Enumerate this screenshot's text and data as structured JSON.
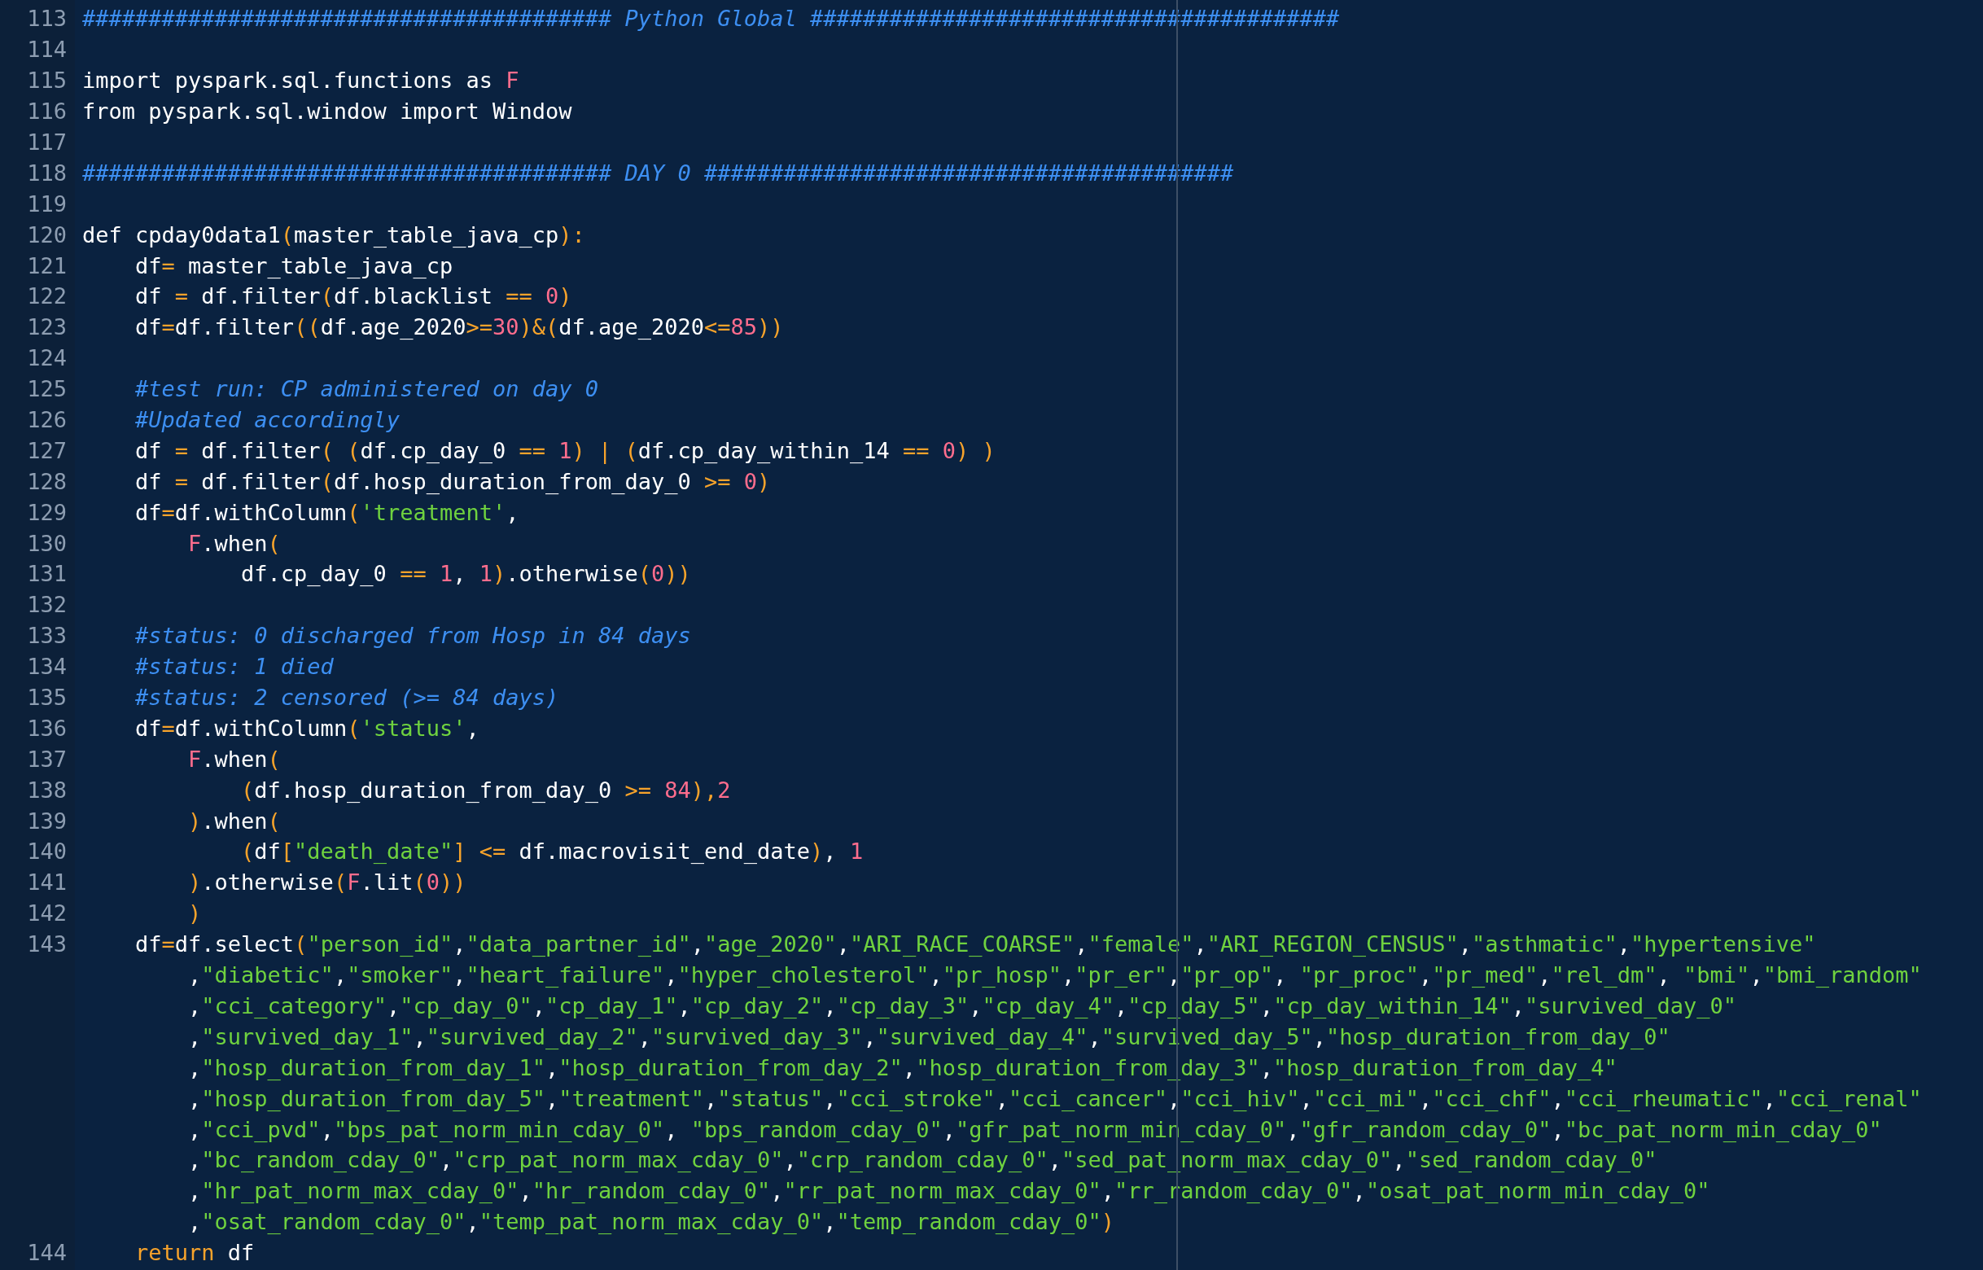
{
  "editor": {
    "rows": [
      {
        "number": "113",
        "segments": [
          {
            "kind": "comment",
            "text": "######################################## Python Global ########################################"
          }
        ]
      },
      {
        "number": "114",
        "segments": []
      },
      {
        "number": "115",
        "segments": [
          {
            "kind": "plain",
            "text": "import pyspark.sql.functions as "
          },
          {
            "kind": "constant",
            "text": "F"
          }
        ]
      },
      {
        "number": "116",
        "segments": [
          {
            "kind": "plain",
            "text": "from pyspark.sql.window import Window"
          }
        ]
      },
      {
        "number": "117",
        "segments": []
      },
      {
        "number": "118",
        "segments": [
          {
            "kind": "comment",
            "text": "######################################## DAY 0 ########################################"
          }
        ]
      },
      {
        "number": "119",
        "segments": []
      },
      {
        "number": "120",
        "segments": [
          {
            "kind": "plain",
            "text": "def cpday0data1"
          },
          {
            "kind": "operator",
            "text": "("
          },
          {
            "kind": "plain",
            "text": "master_table_java_cp"
          },
          {
            "kind": "operator",
            "text": "):"
          }
        ]
      },
      {
        "number": "121",
        "segments": [
          {
            "kind": "plain",
            "text": "    df"
          },
          {
            "kind": "operator",
            "text": "="
          },
          {
            "kind": "plain",
            "text": " master_table_java_cp"
          }
        ]
      },
      {
        "number": "122",
        "segments": [
          {
            "kind": "plain",
            "text": "    df "
          },
          {
            "kind": "operator",
            "text": "="
          },
          {
            "kind": "plain",
            "text": " df.filter"
          },
          {
            "kind": "operator",
            "text": "("
          },
          {
            "kind": "plain",
            "text": "df.blacklist "
          },
          {
            "kind": "operator",
            "text": "== "
          },
          {
            "kind": "number",
            "text": "0"
          },
          {
            "kind": "operator",
            "text": ")"
          }
        ]
      },
      {
        "number": "123",
        "segments": [
          {
            "kind": "plain",
            "text": "    df"
          },
          {
            "kind": "operator",
            "text": "="
          },
          {
            "kind": "plain",
            "text": "df.filter"
          },
          {
            "kind": "operator",
            "text": "(("
          },
          {
            "kind": "plain",
            "text": "df.age_2020"
          },
          {
            "kind": "operator",
            "text": ">="
          },
          {
            "kind": "number",
            "text": "30"
          },
          {
            "kind": "operator",
            "text": ")&("
          },
          {
            "kind": "plain",
            "text": "df.age_2020"
          },
          {
            "kind": "operator",
            "text": "<="
          },
          {
            "kind": "number",
            "text": "85"
          },
          {
            "kind": "operator",
            "text": "))"
          }
        ]
      },
      {
        "number": "124",
        "segments": []
      },
      {
        "number": "125",
        "segments": [
          {
            "kind": "comment",
            "text": "    #test run: CP administered on day 0"
          }
        ]
      },
      {
        "number": "126",
        "segments": [
          {
            "kind": "comment",
            "text": "    #Updated accordingly"
          }
        ]
      },
      {
        "number": "127",
        "segments": [
          {
            "kind": "plain",
            "text": "    df "
          },
          {
            "kind": "operator",
            "text": "="
          },
          {
            "kind": "plain",
            "text": " df.filter"
          },
          {
            "kind": "operator",
            "text": "( ("
          },
          {
            "kind": "plain",
            "text": "df.cp_day_0 "
          },
          {
            "kind": "operator",
            "text": "== "
          },
          {
            "kind": "number",
            "text": "1"
          },
          {
            "kind": "operator",
            "text": ") | ("
          },
          {
            "kind": "plain",
            "text": "df.cp_day_within_14 "
          },
          {
            "kind": "operator",
            "text": "== "
          },
          {
            "kind": "number",
            "text": "0"
          },
          {
            "kind": "operator",
            "text": ") )"
          }
        ]
      },
      {
        "number": "128",
        "segments": [
          {
            "kind": "plain",
            "text": "    df "
          },
          {
            "kind": "operator",
            "text": "="
          },
          {
            "kind": "plain",
            "text": " df.filter"
          },
          {
            "kind": "operator",
            "text": "("
          },
          {
            "kind": "plain",
            "text": "df.hosp_duration_from_day_0 "
          },
          {
            "kind": "operator",
            "text": ">= "
          },
          {
            "kind": "number",
            "text": "0"
          },
          {
            "kind": "operator",
            "text": ")"
          }
        ]
      },
      {
        "number": "129",
        "segments": [
          {
            "kind": "plain",
            "text": "    df"
          },
          {
            "kind": "operator",
            "text": "="
          },
          {
            "kind": "plain",
            "text": "df.withColumn"
          },
          {
            "kind": "operator",
            "text": "("
          },
          {
            "kind": "string",
            "text": "'treatment'"
          },
          {
            "kind": "plain",
            "text": ","
          }
        ]
      },
      {
        "number": "130",
        "segments": [
          {
            "kind": "constant",
            "text": "        F"
          },
          {
            "kind": "plain",
            "text": ".when"
          },
          {
            "kind": "operator",
            "text": "("
          }
        ]
      },
      {
        "number": "131",
        "segments": [
          {
            "kind": "plain",
            "text": "            df.cp_day_0 "
          },
          {
            "kind": "operator",
            "text": "== "
          },
          {
            "kind": "number",
            "text": "1"
          },
          {
            "kind": "plain",
            "text": ", "
          },
          {
            "kind": "number",
            "text": "1"
          },
          {
            "kind": "operator",
            "text": ")"
          },
          {
            "kind": "plain",
            "text": ".otherwise"
          },
          {
            "kind": "operator",
            "text": "("
          },
          {
            "kind": "number",
            "text": "0"
          },
          {
            "kind": "operator",
            "text": "))"
          }
        ]
      },
      {
        "number": "132",
        "segments": []
      },
      {
        "number": "133",
        "segments": [
          {
            "kind": "comment",
            "text": "    #status: 0 discharged from Hosp in 84 days"
          }
        ]
      },
      {
        "number": "134",
        "segments": [
          {
            "kind": "comment",
            "text": "    #status: 1 died"
          }
        ]
      },
      {
        "number": "135",
        "segments": [
          {
            "kind": "comment",
            "text": "    #status: 2 censored (>= 84 days)"
          }
        ]
      },
      {
        "number": "136",
        "segments": [
          {
            "kind": "plain",
            "text": "    df"
          },
          {
            "kind": "operator",
            "text": "="
          },
          {
            "kind": "plain",
            "text": "df.withColumn"
          },
          {
            "kind": "operator",
            "text": "("
          },
          {
            "kind": "string",
            "text": "'status'"
          },
          {
            "kind": "plain",
            "text": ","
          }
        ]
      },
      {
        "number": "137",
        "segments": [
          {
            "kind": "constant",
            "text": "        F"
          },
          {
            "kind": "plain",
            "text": ".when"
          },
          {
            "kind": "operator",
            "text": "("
          }
        ]
      },
      {
        "number": "138",
        "segments": [
          {
            "kind": "operator",
            "text": "            ("
          },
          {
            "kind": "plain",
            "text": "df.hosp_duration_from_day_0 "
          },
          {
            "kind": "operator",
            "text": ">= "
          },
          {
            "kind": "number",
            "text": "84"
          },
          {
            "kind": "operator",
            "text": "),"
          },
          {
            "kind": "number",
            "text": "2"
          }
        ]
      },
      {
        "number": "139",
        "segments": [
          {
            "kind": "operator",
            "text": "        )"
          },
          {
            "kind": "plain",
            "text": ".when"
          },
          {
            "kind": "operator",
            "text": "("
          }
        ]
      },
      {
        "number": "140",
        "segments": [
          {
            "kind": "operator",
            "text": "            ("
          },
          {
            "kind": "plain",
            "text": "df"
          },
          {
            "kind": "operator",
            "text": "["
          },
          {
            "kind": "string",
            "text": "\"death_date\""
          },
          {
            "kind": "operator",
            "text": "] <="
          },
          {
            "kind": "plain",
            "text": " df.macrovisit_end_date"
          },
          {
            "kind": "operator",
            "text": ")"
          },
          {
            "kind": "plain",
            "text": ", "
          },
          {
            "kind": "number",
            "text": "1"
          }
        ]
      },
      {
        "number": "141",
        "segments": [
          {
            "kind": "operator",
            "text": "        )"
          },
          {
            "kind": "plain",
            "text": ".otherwise"
          },
          {
            "kind": "operator",
            "text": "("
          },
          {
            "kind": "constant",
            "text": "F"
          },
          {
            "kind": "plain",
            "text": ".lit"
          },
          {
            "kind": "operator",
            "text": "("
          },
          {
            "kind": "number",
            "text": "0"
          },
          {
            "kind": "operator",
            "text": "))"
          }
        ]
      },
      {
        "number": "142",
        "segments": [
          {
            "kind": "operator",
            "text": "        )"
          }
        ]
      },
      {
        "number": "143",
        "segments": [
          {
            "kind": "plain",
            "text": "    df"
          },
          {
            "kind": "operator",
            "text": "="
          },
          {
            "kind": "plain",
            "text": "df.select"
          },
          {
            "kind": "operator",
            "text": "("
          },
          {
            "kind": "args",
            "text": "\"person_id\",\"data_partner_id\",\"age_2020\",\"ARI_RACE_COARSE\",\"female\",\"ARI_REGION_CENSUS\",\"asthmatic\",\"hypertensive\""
          }
        ]
      },
      {
        "segments": [
          {
            "kind": "args",
            "text": "        ,\"diabetic\",\"smoker\",\"heart_failure\",\"hyper_cholesterol\",\"pr_hosp\",\"pr_er\",\"pr_op\", \"pr_proc\",\"pr_med\",\"rel_dm\", \"bmi\",\"bmi_random\""
          }
        ]
      },
      {
        "segments": [
          {
            "kind": "args",
            "text": "        ,\"cci_category\",\"cp_day_0\",\"cp_day_1\",\"cp_day_2\",\"cp_day_3\",\"cp_day_4\",\"cp_day_5\",\"cp_day_within_14\",\"survived_day_0\""
          }
        ]
      },
      {
        "segments": [
          {
            "kind": "args",
            "text": "        ,\"survived_day_1\",\"survived_day_2\",\"survived_day_3\",\"survived_day_4\",\"survived_day_5\",\"hosp_duration_from_day_0\""
          }
        ]
      },
      {
        "segments": [
          {
            "kind": "args",
            "text": "        ,\"hosp_duration_from_day_1\",\"hosp_duration_from_day_2\",\"hosp_duration_from_day_3\",\"hosp_duration_from_day_4\""
          }
        ]
      },
      {
        "segments": [
          {
            "kind": "args",
            "text": "        ,\"hosp_duration_from_day_5\",\"treatment\",\"status\",\"cci_stroke\",\"cci_cancer\",\"cci_hiv\",\"cci_mi\",\"cci_chf\",\"cci_rheumatic\",\"cci_renal\""
          }
        ]
      },
      {
        "segments": [
          {
            "kind": "args",
            "text": "        ,\"cci_pvd\",\"bps_pat_norm_min_cday_0\", \"bps_random_cday_0\",\"gfr_pat_norm_min_cday_0\",\"gfr_random_cday_0\",\"bc_pat_norm_min_cday_0\""
          }
        ]
      },
      {
        "segments": [
          {
            "kind": "args",
            "text": "        ,\"bc_random_cday_0\",\"crp_pat_norm_max_cday_0\",\"crp_random_cday_0\",\"sed_pat_norm_max_cday_0\",\"sed_random_cday_0\""
          }
        ]
      },
      {
        "segments": [
          {
            "kind": "args",
            "text": "        ,\"hr_pat_norm_max_cday_0\",\"hr_random_cday_0\",\"rr_pat_norm_max_cday_0\",\"rr_random_cday_0\",\"osat_pat_norm_min_cday_0\""
          }
        ]
      },
      {
        "segments": [
          {
            "kind": "args",
            "text": "        ,\"osat_random_cday_0\",\"temp_pat_norm_max_cday_0\",\"temp_random_cday_0\")"
          }
        ]
      },
      {
        "number": "144",
        "segments": [
          {
            "kind": "keyword",
            "text": "    return"
          },
          {
            "kind": "plain",
            "text": " df"
          }
        ]
      }
    ]
  }
}
